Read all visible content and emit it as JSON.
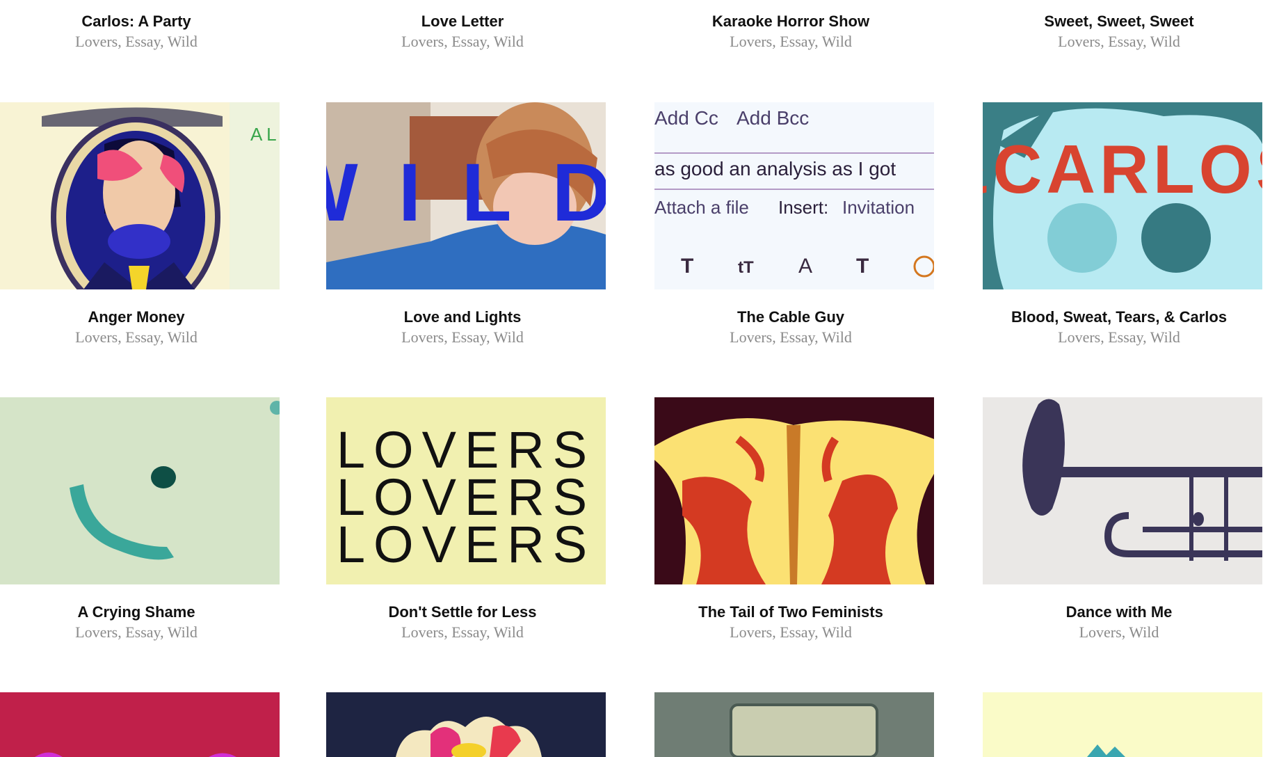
{
  "posts": [
    {
      "title": "Carlos: A Party",
      "tags": [
        "Lovers",
        "Essay",
        "Wild"
      ]
    },
    {
      "title": "Love Letter",
      "tags": [
        "Lovers",
        "Essay",
        "Wild"
      ]
    },
    {
      "title": "Karaoke Horror Show",
      "tags": [
        "Lovers",
        "Essay",
        "Wild"
      ]
    },
    {
      "title": "Sweet, Sweet, Sweet",
      "tags": [
        "Lovers",
        "Essay",
        "Wild"
      ]
    },
    {
      "title": "Anger Money",
      "tags": [
        "Lovers",
        "Essay",
        "Wild"
      ]
    },
    {
      "title": "Love and Lights",
      "tags": [
        "Lovers",
        "Essay",
        "Wild"
      ]
    },
    {
      "title": "The Cable Guy",
      "tags": [
        "Lovers",
        "Essay",
        "Wild"
      ]
    },
    {
      "title": "Blood, Sweat, Tears, & Carlos",
      "tags": [
        "Lovers",
        "Essay",
        "Wild"
      ]
    },
    {
      "title": "A Crying Shame",
      "tags": [
        "Lovers",
        "Essay",
        "Wild"
      ]
    },
    {
      "title": "Don't Settle for Less",
      "tags": [
        "Lovers",
        "Essay",
        "Wild"
      ]
    },
    {
      "title": "The Tail of Two Feminists",
      "tags": [
        "Lovers",
        "Essay",
        "Wild"
      ]
    },
    {
      "title": "Dance with Me",
      "tags": [
        "Lovers",
        "Wild"
      ]
    }
  ],
  "thumb_text": {
    "wild": "WILD",
    "email": {
      "add_cc": "Add Cc",
      "add_bcc": "Add Bcc",
      "body": "as good an analysis as I got",
      "attach": "Attach a file",
      "insert": "Insert:",
      "invitation": "Invitation",
      "toolbar": [
        "T",
        "tT",
        "A",
        "T"
      ]
    },
    "carlos": "&CARLOS",
    "lovers": [
      "LOVERS",
      "LOVERS",
      "LOVERS"
    ]
  }
}
